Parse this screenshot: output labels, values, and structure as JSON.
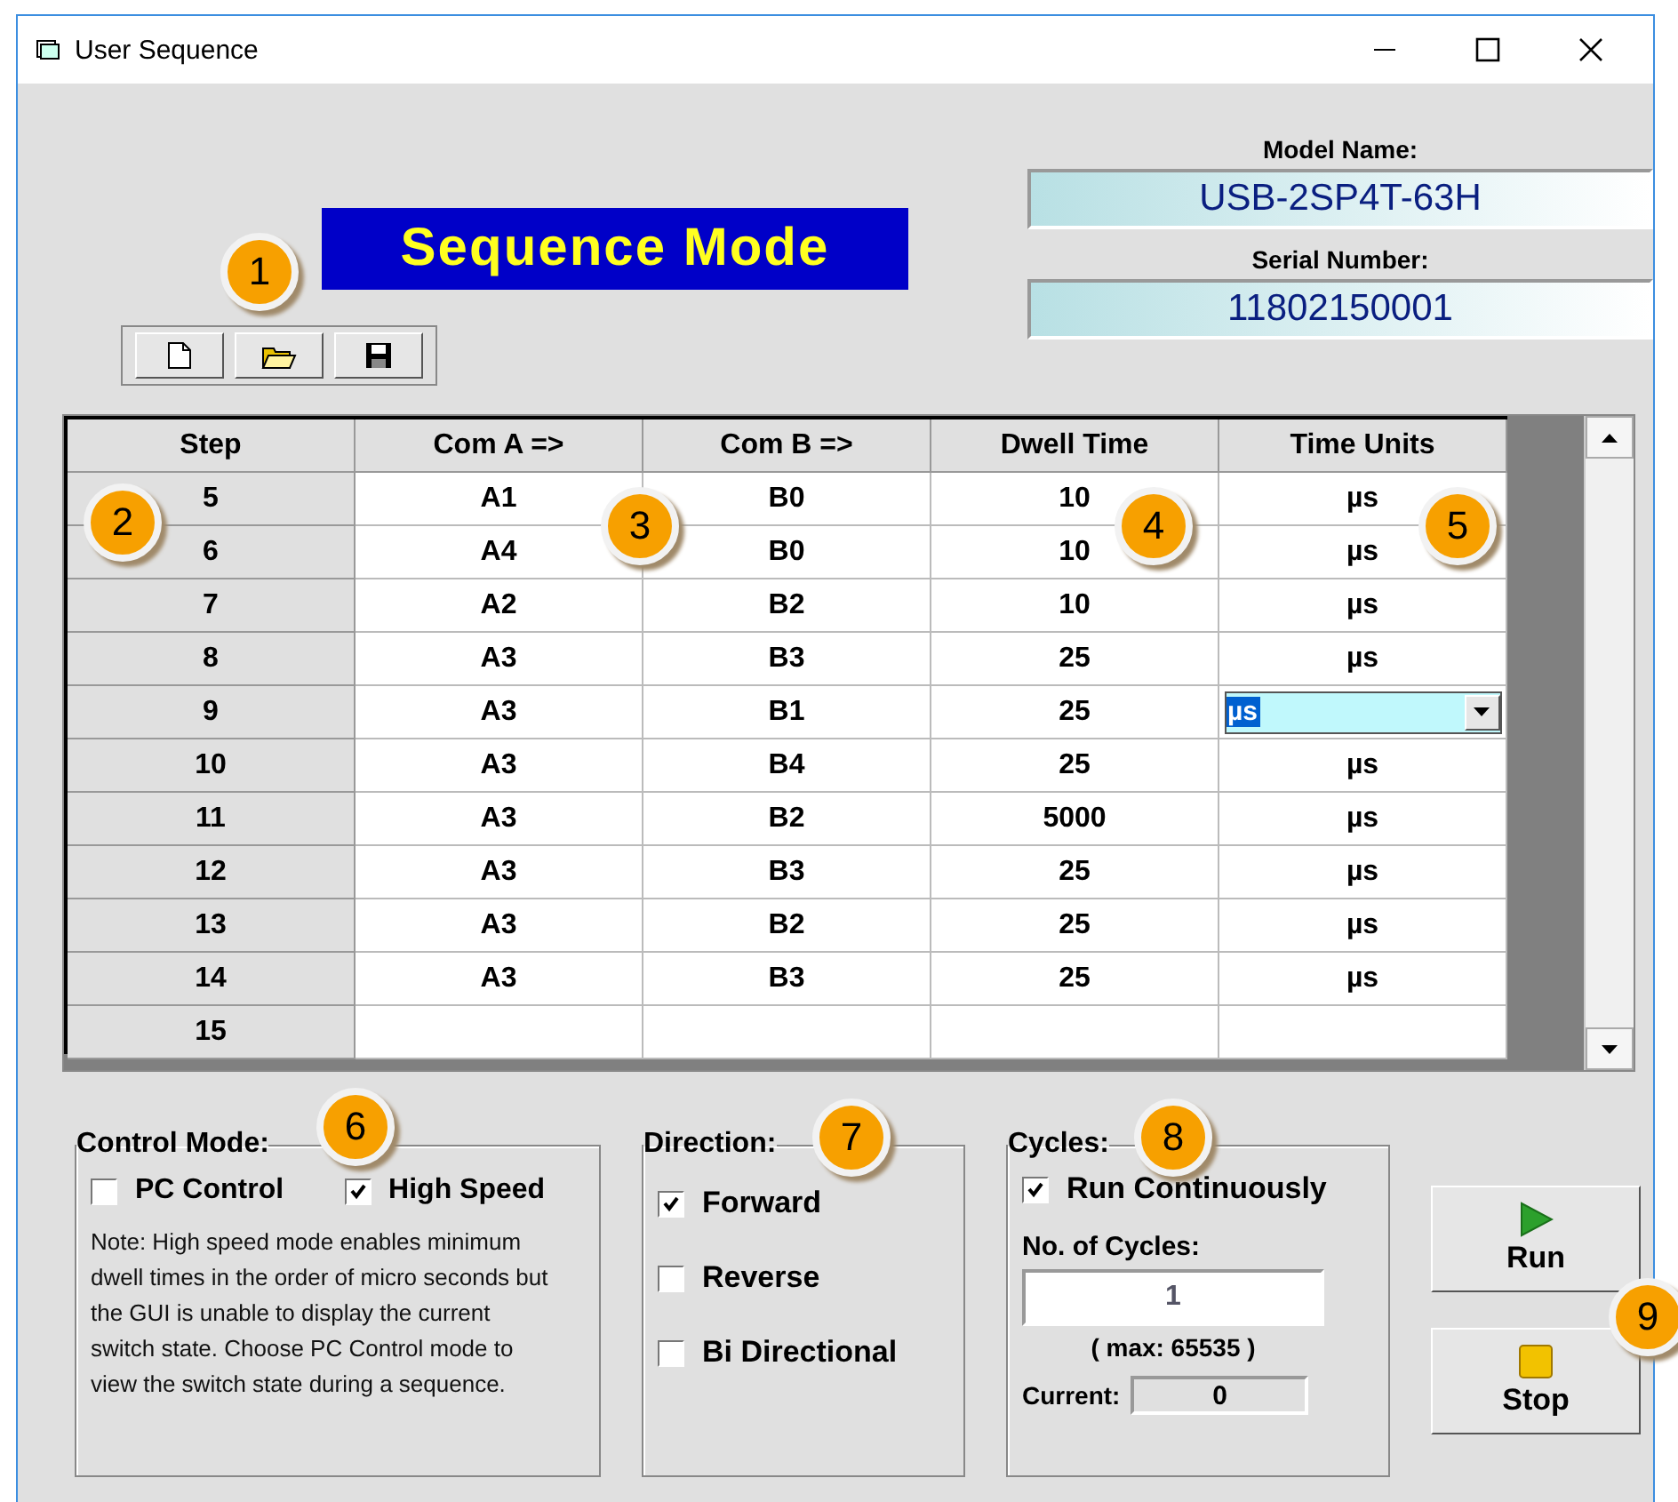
{
  "window": {
    "title": "User Sequence"
  },
  "banner": "Sequence Mode",
  "model_name": {
    "label": "Model Name:",
    "value": "USB-2SP4T-63H"
  },
  "serial_number": {
    "label": "Serial Number:",
    "value": "11802150001"
  },
  "table": {
    "columns": [
      "Step",
      "Com A =>",
      "Com B =>",
      "Dwell Time",
      "Time Units"
    ],
    "rows": [
      {
        "step": "5",
        "com_a": "A1",
        "com_b": "B0",
        "dwell": "10",
        "units": "µs",
        "editing": false
      },
      {
        "step": "6",
        "com_a": "A4",
        "com_b": "B0",
        "dwell": "10",
        "units": "µs",
        "editing": false
      },
      {
        "step": "7",
        "com_a": "A2",
        "com_b": "B2",
        "dwell": "10",
        "units": "µs",
        "editing": false
      },
      {
        "step": "8",
        "com_a": "A3",
        "com_b": "B3",
        "dwell": "25",
        "units": "µs",
        "editing": false
      },
      {
        "step": "9",
        "com_a": "A3",
        "com_b": "B1",
        "dwell": "25",
        "units": "µs",
        "editing": true
      },
      {
        "step": "10",
        "com_a": "A3",
        "com_b": "B4",
        "dwell": "25",
        "units": "µs",
        "editing": false
      },
      {
        "step": "11",
        "com_a": "A3",
        "com_b": "B2",
        "dwell": "5000",
        "units": "µs",
        "editing": false
      },
      {
        "step": "12",
        "com_a": "A3",
        "com_b": "B3",
        "dwell": "25",
        "units": "µs",
        "editing": false
      },
      {
        "step": "13",
        "com_a": "A3",
        "com_b": "B2",
        "dwell": "25",
        "units": "µs",
        "editing": false
      },
      {
        "step": "14",
        "com_a": "A3",
        "com_b": "B3",
        "dwell": "25",
        "units": "µs",
        "editing": false
      },
      {
        "step": "15",
        "com_a": "",
        "com_b": "",
        "dwell": "",
        "units": "",
        "editing": false
      }
    ]
  },
  "control_mode": {
    "title": "Control Mode:",
    "options": [
      {
        "label": "PC Control",
        "checked": false
      },
      {
        "label": "High Speed",
        "checked": true
      }
    ],
    "note": "Note: High speed mode enables minimum dwell times in the order of micro seconds but the GUI is unable to display the current switch state. Choose PC Control mode to view the switch state during a sequence."
  },
  "direction": {
    "title": "Direction:",
    "options": [
      {
        "label": "Forward",
        "checked": true
      },
      {
        "label": "Reverse",
        "checked": false
      },
      {
        "label": "Bi Directional",
        "checked": false
      }
    ]
  },
  "cycles": {
    "title": "Cycles:",
    "run_continuously": {
      "label": "Run Continuously",
      "checked": true
    },
    "count_label": "No. of Cycles:",
    "count": "1",
    "max": "( max: 65535 )",
    "current_label": "Current:",
    "current": "0"
  },
  "buttons": [
    {
      "label": "Run",
      "kind": "run"
    },
    {
      "label": "Stop",
      "kind": "stop"
    }
  ],
  "callouts": [
    "1",
    "2",
    "3",
    "4",
    "5",
    "6",
    "7",
    "8",
    "9"
  ]
}
